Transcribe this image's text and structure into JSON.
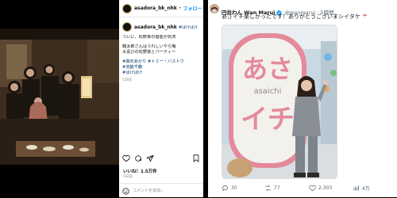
{
  "instagram": {
    "username": "asadora_bk_nhk",
    "follow_label": "フォロー",
    "tag_line": "#ばけばけ",
    "caption_lines": [
      "ついに、松野家の借金が完済",
      "銭太郎さんはうれしいやら悔",
      "大喜びの松野家とパーティー"
    ],
    "hashtag_lines": [
      "#高石あかり #トミー・バストウ",
      "#池脇千鶴",
      "#ばけばけ"
    ],
    "post_time": "1日前",
    "likes": "いいね！1.5万件",
    "date": "1日前",
    "comment_placeholder": "コメントを追加..."
  },
  "tweet": {
    "display_name": "円井わん Wan Marui",
    "handle": "@wanmarui · 5時間",
    "text": "あさイチ楽しかったです！ありがとうございまシイタケ",
    "stats": {
      "replies": "30",
      "retweets": "77",
      "likes": "2,303",
      "views": "4万"
    },
    "image_sign": {
      "line1": "あさ",
      "romaji": "asaichi",
      "line2": "イチ"
    }
  },
  "icons": [
    "heart-icon",
    "comment-icon",
    "share-icon",
    "bookmark-icon",
    "emoji-icon",
    "verified-icon",
    "reply-icon",
    "retweet-icon",
    "like-icon",
    "views-icon",
    "mushroom-emoji"
  ],
  "colors": {
    "instagram_link": "#0095f6",
    "twitter_verified": "#1d9bf0",
    "sign_pink": "#e48a9b"
  }
}
